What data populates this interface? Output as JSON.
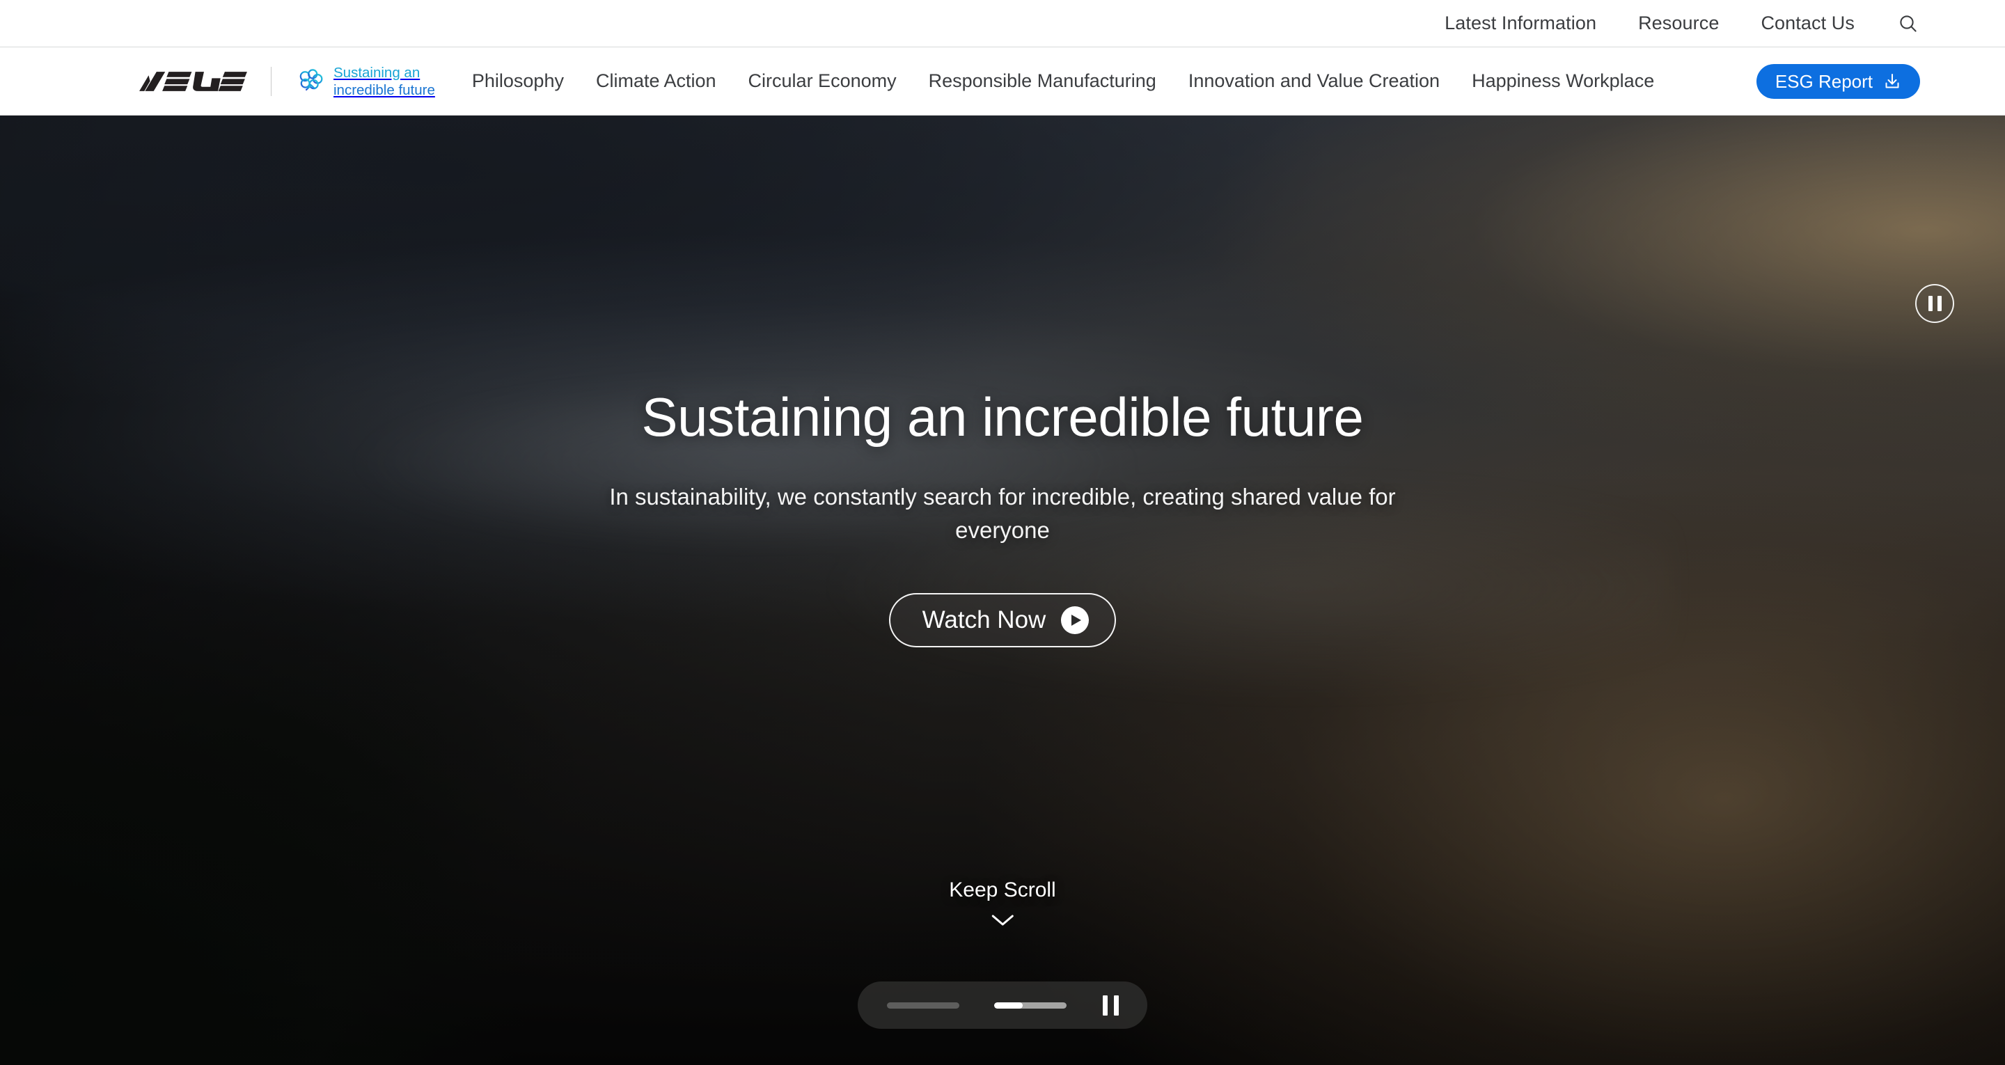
{
  "utility_bar": {
    "links": [
      {
        "label": "Latest Information"
      },
      {
        "label": "Resource"
      },
      {
        "label": "Contact Us"
      }
    ],
    "search_icon": "search-icon"
  },
  "main_nav": {
    "brand": {
      "logo_alt": "ASUS",
      "sustain_line1": "Sustaining an",
      "sustain_line2": "incredible future",
      "tree_icon": "tree-icon"
    },
    "links": [
      {
        "label": "Philosophy"
      },
      {
        "label": "Climate Action"
      },
      {
        "label": "Circular Economy"
      },
      {
        "label": "Responsible Manufacturing"
      },
      {
        "label": "Innovation and Value Creation"
      },
      {
        "label": "Happiness Workplace"
      }
    ],
    "esg_button": {
      "label": "ESG Report",
      "icon": "download-icon",
      "color": "#0d6fe0"
    }
  },
  "hero": {
    "title": "Sustaining an incredible future",
    "subtitle": "In sustainability, we constantly search for incredible, creating shared value for everyone",
    "watch_button": {
      "label": "Watch Now",
      "icon": "play-icon"
    },
    "scroll_hint": {
      "label": "Keep Scroll",
      "icon": "chevron-down-icon"
    },
    "pause_toggle": {
      "icon": "pause-icon",
      "state": "playing"
    },
    "media_controls": {
      "slides": [
        {
          "index": 1,
          "progress_percent": 0,
          "active": false
        },
        {
          "index": 2,
          "progress_percent": 40,
          "active": true
        }
      ],
      "pause_icon": "pause-icon"
    }
  },
  "theme": {
    "accent_blue": "#0d6fe0",
    "nav_text": "#3b3d40",
    "hero_text": "#ffffff",
    "tree_cyan": "#18a4d4",
    "tree_blue": "#1a75d2"
  }
}
